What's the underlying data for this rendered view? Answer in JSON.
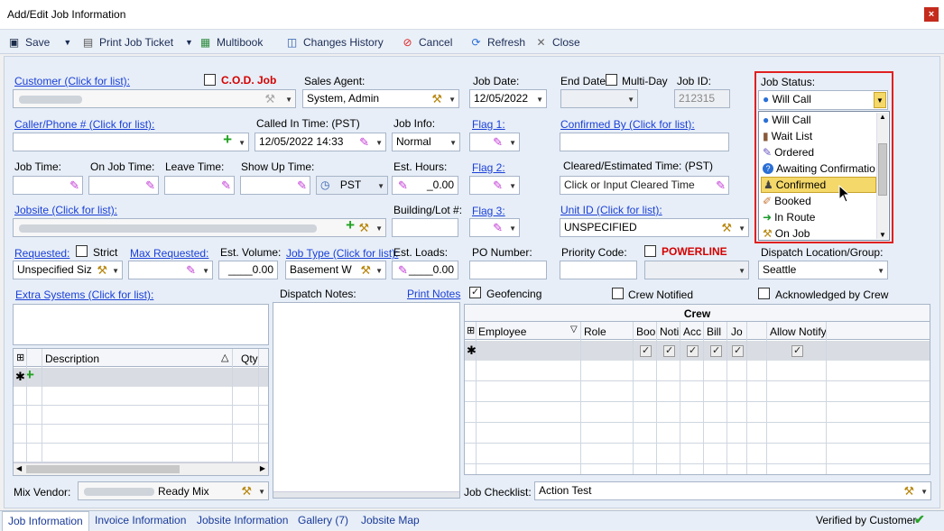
{
  "window": {
    "title": "Add/Edit Job Information",
    "close": "×"
  },
  "toolbar": {
    "save": "Save",
    "print": "Print Job Ticket",
    "multibook": "Multibook",
    "history": "Changes History",
    "cancel": "Cancel",
    "refresh": "Refresh",
    "close": "Close"
  },
  "customer": {
    "label": "Customer (Click for list):",
    "cod": "C.O.D. Job"
  },
  "sales_agent": {
    "label": "Sales Agent:",
    "value": "System, Admin"
  },
  "job_date": {
    "label": "Job Date:",
    "value": "12/05/2022"
  },
  "end_date": {
    "label": "End Date:",
    "multiday": "Multi-Day"
  },
  "job_id": {
    "label": "Job ID:",
    "value": "212315"
  },
  "job_status": {
    "label": "Job Status:",
    "value": "Will Call",
    "options": [
      {
        "label": "Will Call",
        "icon": "●"
      },
      {
        "label": "Wait List",
        "icon": "▮"
      },
      {
        "label": "Ordered",
        "icon": "✎"
      },
      {
        "label": "Awaiting Confirmatio",
        "icon": "?"
      },
      {
        "label": "Confirmed",
        "icon": "♟"
      },
      {
        "label": "Booked",
        "icon": "✐"
      },
      {
        "label": "In Route",
        "icon": "➜"
      },
      {
        "label": "On Job",
        "icon": "⚒"
      }
    ]
  },
  "caller": {
    "label": "Caller/Phone # (Click for list):"
  },
  "called_in": {
    "label": "Called In Time: (PST)",
    "value": "12/05/2022 14:33"
  },
  "job_info": {
    "label": "Job Info:",
    "value": "Normal"
  },
  "flag1": {
    "label": "Flag 1:"
  },
  "confirmed_by": {
    "label": "Confirmed By (Click for list):"
  },
  "times": {
    "job_time": "Job Time:",
    "on_job_time": "On Job Time:",
    "leave_time": "Leave Time:",
    "show_up_time": "Show Up Time:",
    "tz": "PST",
    "est_hours_label": "Est. Hours:",
    "est_hours": "_0.00"
  },
  "flag2": {
    "label": "Flag 2:"
  },
  "cleared": {
    "label": "Cleared/Estimated Time: (PST)",
    "placeholder": "Click or Input Cleared Time"
  },
  "jobsite": {
    "label": "Jobsite (Click for list):"
  },
  "building": {
    "label": "Building/Lot #:"
  },
  "flag3": {
    "label": "Flag 3:"
  },
  "unit_id": {
    "label": "Unit ID (Click for list):",
    "value": "UNSPECIFIED"
  },
  "requested": {
    "label": "Requested:",
    "strict": "Strict",
    "value": "Unspecified Siz"
  },
  "max_requested": {
    "label": "Max Requested:"
  },
  "est_volume": {
    "label": "Est. Volume:",
    "value": "____0.00"
  },
  "job_type": {
    "label": "Job Type (Click for list):",
    "value": "Basement W"
  },
  "est_loads": {
    "label": "Est. Loads:",
    "value": "____0.00"
  },
  "po_number": {
    "label": "PO Number:"
  },
  "priority": {
    "label": "Priority Code:",
    "powerline": "POWERLINE"
  },
  "dispatch_location": {
    "label": "Dispatch Location/Group:",
    "value": "Seattle"
  },
  "extra_systems": {
    "label": "Extra Systems (Click for list):",
    "col_description": "Description",
    "col_qty": "Qty"
  },
  "dispatch_notes": {
    "label": "Dispatch Notes:",
    "print": "Print Notes"
  },
  "geofencing": "Geofencing",
  "crew_notified": "Crew Notified",
  "ack_by_crew": "Acknowledged by Crew",
  "crew": {
    "title": "Crew",
    "columns": [
      "Employee",
      "Role",
      "Boo",
      "Noti",
      "Acc",
      "Bill",
      "Jo",
      "",
      "Allow Notify"
    ]
  },
  "mix_vendor": {
    "label": "Mix Vendor:",
    "value": "Ready Mix"
  },
  "checklist": {
    "label": "Job Checklist:",
    "value": "Action Test"
  },
  "tabs": [
    "Job Information",
    "Invoice Information",
    "Jobsite Information",
    "Gallery (7)",
    "Jobsite Map"
  ],
  "verified": "Verified by Customer"
}
